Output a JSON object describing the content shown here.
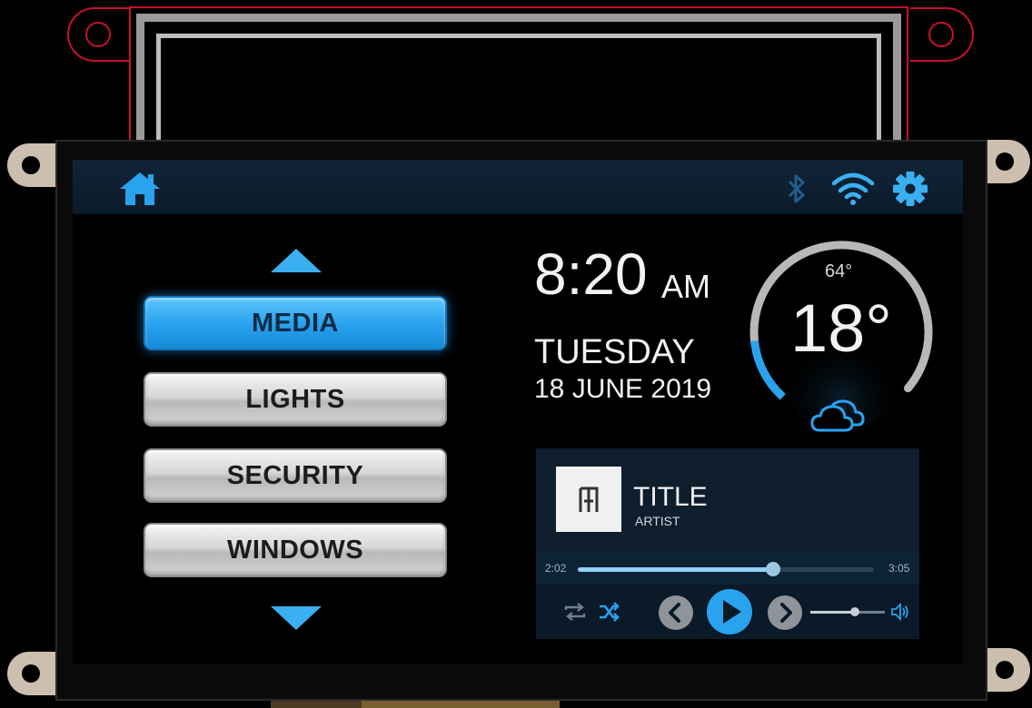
{
  "statusbar": {
    "home_icon": "home-icon",
    "bluetooth_icon": "bluetooth-icon",
    "wifi_icon": "wifi-icon",
    "settings_icon": "gear-icon"
  },
  "menu": {
    "items": [
      {
        "label": "MEDIA",
        "active": true
      },
      {
        "label": "LIGHTS",
        "active": false
      },
      {
        "label": "SECURITY",
        "active": false
      },
      {
        "label": "WINDOWS",
        "active": false
      }
    ]
  },
  "clock": {
    "time": "8:20",
    "ampm": "AM",
    "day": "TUESDAY",
    "date": "18 JUNE 2019"
  },
  "weather": {
    "temperature": "18°",
    "high": "64°",
    "dial_fraction": 0.12,
    "condition_icon": "cloud-icon"
  },
  "player": {
    "title": "TITLE",
    "artist": "ARTIST",
    "elapsed": "2:02",
    "duration": "3:05",
    "progress_fraction": 0.66,
    "volume_fraction": 0.6
  },
  "colors": {
    "accent": "#2aa3ee",
    "statusbar": "#102437",
    "player_bg": "#0f1e2d"
  }
}
